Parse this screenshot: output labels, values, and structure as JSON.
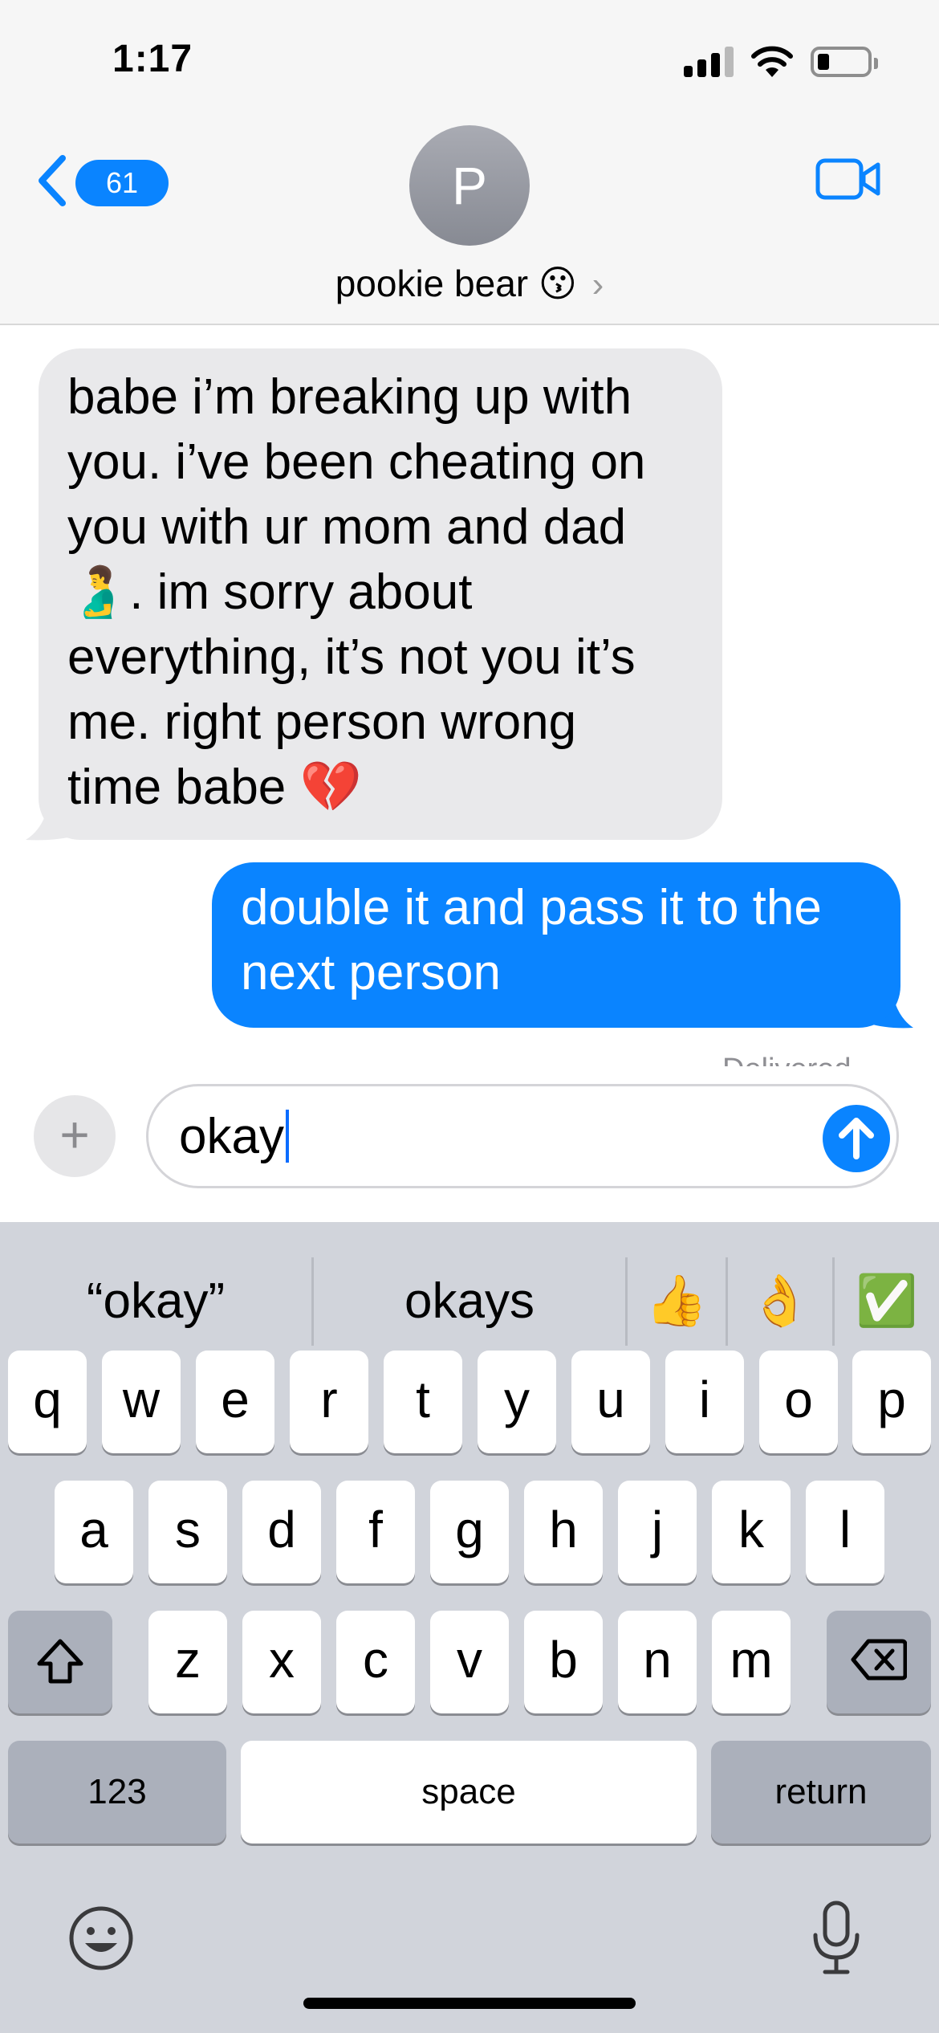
{
  "status_bar": {
    "time": "1:17"
  },
  "header": {
    "back_count": "61",
    "avatar_initial": "P",
    "contact_name": "pookie bear",
    "contact_emoji": "😗",
    "chevron": "›"
  },
  "messages": {
    "received_text": "babe i’m breaking up with\nyou. i’ve been cheating on\nyou with ur mom and dad\n🫃. im sorry about\neverything, it’s not you it’s\nme. right person wrong\ntime babe 💔",
    "sent_text": "double it and pass it to the\nnext person",
    "status": "Delivered"
  },
  "composer": {
    "plus": "+",
    "input_value": "okay"
  },
  "keyboard": {
    "suggestions": [
      "“okay”",
      "okays",
      "👍",
      "👌",
      "✅"
    ],
    "row1": [
      "q",
      "w",
      "e",
      "r",
      "t",
      "y",
      "u",
      "i",
      "o",
      "p"
    ],
    "row2": [
      "a",
      "s",
      "d",
      "f",
      "g",
      "h",
      "j",
      "k",
      "l"
    ],
    "row3": [
      "z",
      "x",
      "c",
      "v",
      "b",
      "n",
      "m"
    ],
    "numbers_label": "123",
    "space_label": "space",
    "return_label": "return"
  },
  "icons": {
    "back": "chevron-left-icon",
    "video": "video-camera-icon",
    "send": "arrow-up-icon",
    "shift": "shift-icon",
    "delete": "delete-backspace-icon",
    "emoji": "emoji-face-icon",
    "mic": "microphone-icon"
  },
  "colors": {
    "accent": "#0a84ff",
    "received_bubble": "#e9e9eb",
    "keyboard_bg": "#d1d4db"
  }
}
